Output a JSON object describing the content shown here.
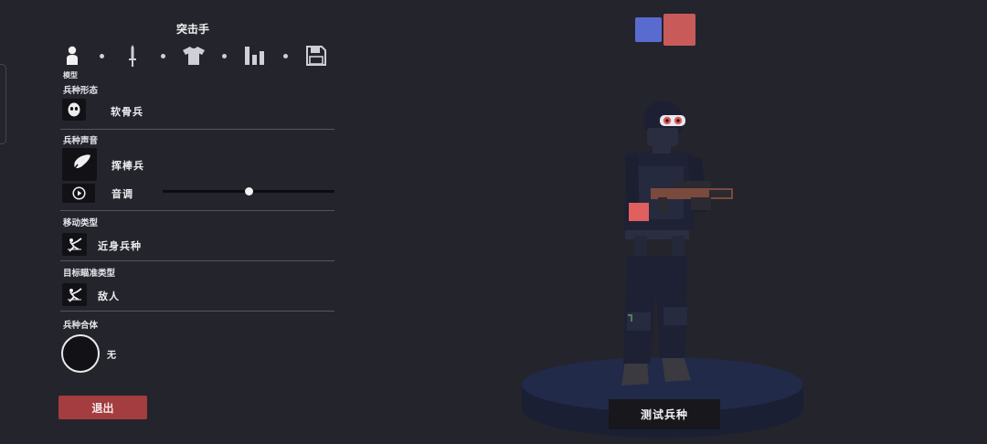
{
  "panel": {
    "title": "突击手"
  },
  "tabs": {
    "active_caption": "模型",
    "items": [
      {
        "icon": "person-icon"
      },
      {
        "icon": "sword-icon"
      },
      {
        "icon": "shirt-icon"
      },
      {
        "icon": "stats-icon"
      },
      {
        "icon": "save-icon"
      }
    ]
  },
  "sections": {
    "form": {
      "label": "兵种形态",
      "value": "软骨兵",
      "icon": "mask-icon"
    },
    "voice": {
      "label": "兵种声音",
      "value": "挥棒兵",
      "icon": "feather-icon",
      "pitch_label": "音调",
      "pitch_level": 0.5
    },
    "movement": {
      "label": "移动类型",
      "value": "近身兵种",
      "icon": "melee-icon"
    },
    "targeting": {
      "label": "目标瞄准类型",
      "value": "敌人",
      "icon": "target-enemy-icon"
    },
    "fusion": {
      "label": "兵种合体",
      "value": "无"
    }
  },
  "buttons": {
    "exit": "退出",
    "test": "测试兵种"
  },
  "teams": {
    "blue": "#5a6bd0",
    "red": "#c95a5a"
  }
}
